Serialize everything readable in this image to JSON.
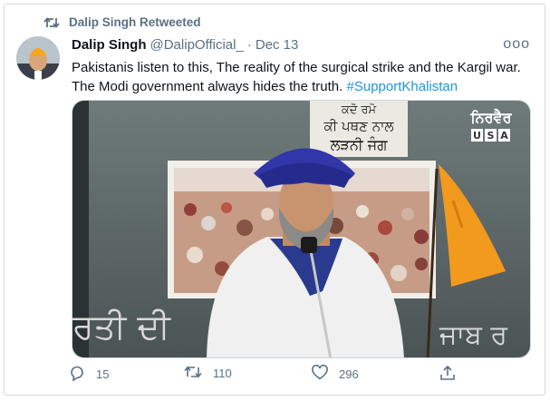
{
  "retweet": {
    "label": "Dalip Singh Retweeted",
    "icon": "retweet-icon"
  },
  "tweet": {
    "name": "Dalip Singh",
    "handle": "@DalipOfficial_",
    "separator": "·",
    "date": "Dec 13",
    "more": "ooo",
    "text": "Pakistanis listen to this, The reality of the surgical strike and the Kargil war. The Modi government always hides the truth. ",
    "hashtag": "#SupportKhalistan",
    "media": {
      "watermark_top": "ਨਿਰਵੈਰ",
      "watermark_letters": [
        "U",
        "S",
        "A"
      ],
      "sign_top": [
        "ਕਦੋ ਰਮੋ",
        "ਕੀ ਪਥਣ ਨਾਲ",
        "ਲੜਨੀ ਜੰਗ"
      ],
      "banner_left": "ਰਤੀ ਦੀ",
      "banner_right": "ਜਾਬ ਰ"
    }
  },
  "actions": {
    "reply": {
      "icon": "reply-icon",
      "count": "15"
    },
    "retweet": {
      "icon": "retweet-icon",
      "count": "110"
    },
    "like": {
      "icon": "heart-icon",
      "count": "296"
    },
    "share": {
      "icon": "share-icon"
    }
  },
  "colors": {
    "secondary_text": "#5b7083",
    "link": "#1b95e0",
    "border": "#d4d9de"
  }
}
